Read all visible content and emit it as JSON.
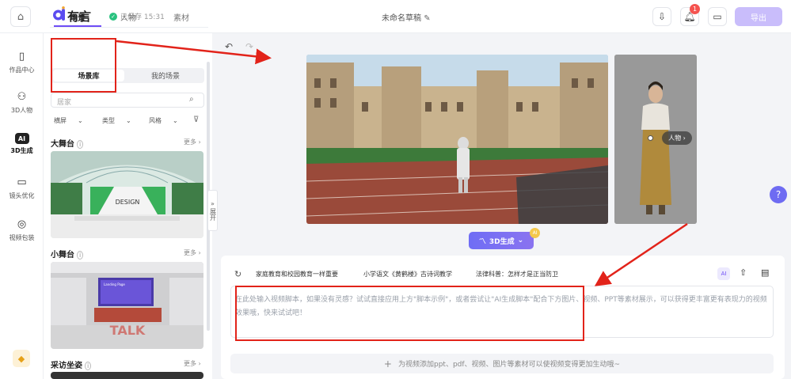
{
  "topbar": {
    "home_icon": "home-icon",
    "logo_text": "有言",
    "saved_text": "已保存 15:31",
    "draft_title": "未命名草稿",
    "edit_icon": "pencil-icon",
    "icons": [
      "cloud-download-icon",
      "bell-icon",
      "folder-icon"
    ],
    "notification_count": "1",
    "export_label": "导出"
  },
  "leftnav": {
    "items": [
      {
        "label": "作品中心",
        "icon": "works-icon"
      },
      {
        "label": "3D人物",
        "icon": "person-icon"
      },
      {
        "label": "3D生成",
        "icon": "ai-icon",
        "badge": "AI"
      },
      {
        "label": "镜头优化",
        "icon": "camera-icon"
      },
      {
        "label": "视频包装",
        "icon": "package-icon"
      }
    ],
    "gem_icon": "diamond-icon"
  },
  "panel": {
    "tabs": [
      "场景",
      "人物",
      "素材"
    ],
    "sub_tabs": [
      "场景库",
      "我的场景"
    ],
    "search_placeholder": "居家",
    "filters": [
      "横屏",
      "类型",
      "风格"
    ],
    "collapse_label": "展开",
    "sections": [
      {
        "title": "大舞台",
        "more": "更多",
        "image_text": "DESIGN"
      },
      {
        "title": "小舞台",
        "more": "更多",
        "image_text": "Landing Page"
      },
      {
        "title": "采访坐姿",
        "more": "更多"
      }
    ],
    "stage_logo_text": "TALK"
  },
  "canvas": {
    "person_label": "人物",
    "gen3d_label": "3D生成",
    "gen3d_badge": "AI"
  },
  "script": {
    "chips": [
      "家庭教育和校园教育一样重要",
      "小学语文《黄鹤楼》古诗词教学",
      "法律科普：怎样才是正当防卫"
    ],
    "placeholder": "在此处输入视频脚本，如果没有灵感？试试直接应用上方\"脚本示例\"，或者尝试让\"AI生成脚本\"配合下方图片、视频、PPT等素材展示，可以获得更丰富更有表现力的视频效果哦，快来试试吧！",
    "add_label": "为视频添加ppt、pdf、视频、图片等素材可以使视频变得更加生动哦~",
    "add_icon": "plus-icon"
  },
  "help_label": "?",
  "colors": {
    "accent": "#6e4cf5",
    "annotation": "#e2231a",
    "export": "#c9bdfb"
  }
}
